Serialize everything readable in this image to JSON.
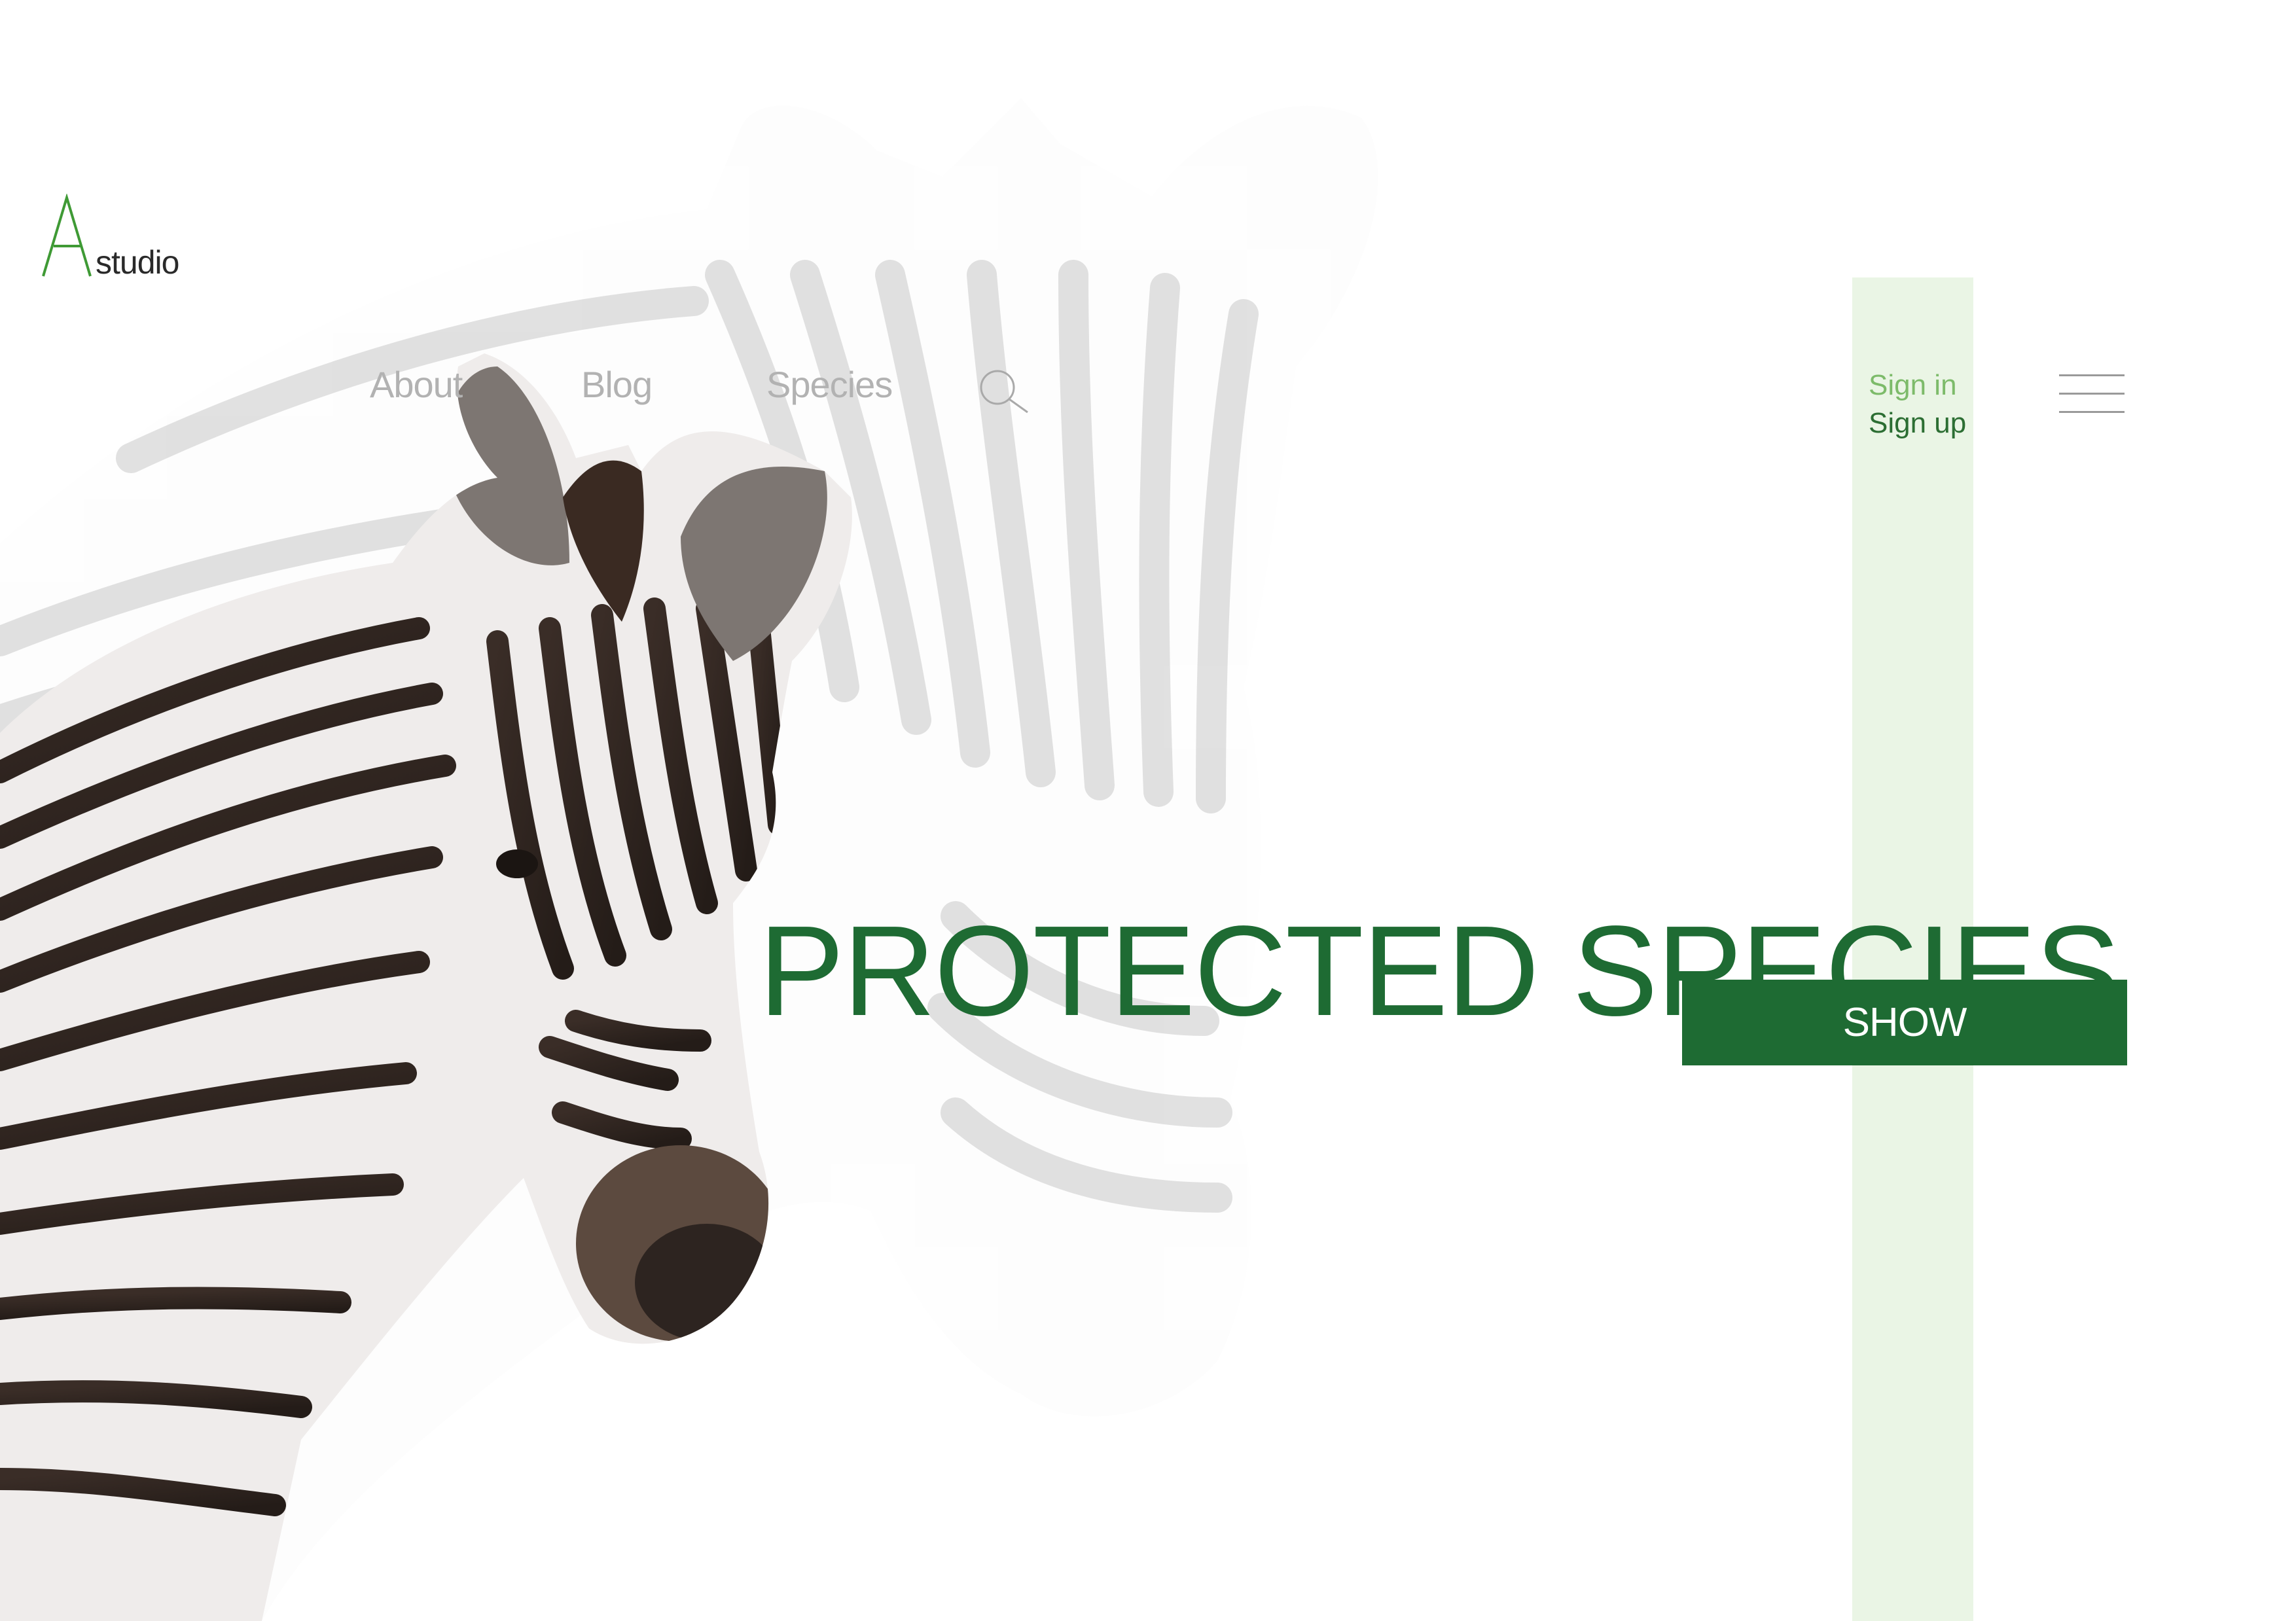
{
  "logo": {
    "mark": "A",
    "text": "studio"
  },
  "nav": {
    "items": [
      {
        "label": "About"
      },
      {
        "label": "Blog"
      },
      {
        "label": "Species"
      }
    ],
    "search_icon": "search-icon"
  },
  "auth": {
    "sign_in_label": "Sign in",
    "sign_up_label": "Sign up"
  },
  "menu_icon": "hamburger-menu-icon",
  "hero": {
    "title": "PROTECTED SPECIES",
    "cta_label": "SHOW"
  },
  "colors": {
    "brand_green": "#1e6b33",
    "light_green": "#7dbb6a",
    "accent_band": "#eaf5e5",
    "nav_text": "#b2b2b2"
  }
}
